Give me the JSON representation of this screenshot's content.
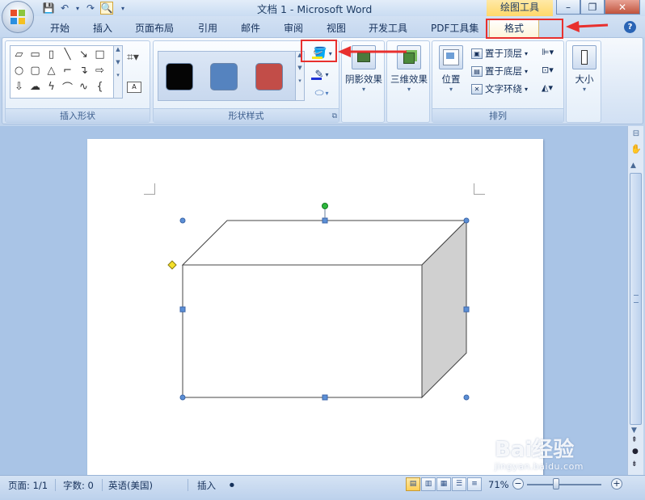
{
  "window": {
    "title": "文档 1 - Microsoft Word",
    "context_title": "绘图工具",
    "minimize": "–",
    "restore": "❐",
    "close": "✕"
  },
  "tabs": [
    "开始",
    "插入",
    "页面布局",
    "引用",
    "邮件",
    "审阅",
    "视图",
    "开发工具",
    "PDF工具集"
  ],
  "active_tab": "格式",
  "ribbon": {
    "insert_shapes_label": "插入形状",
    "shape_styles_label": "形状样式",
    "shadow_effects": "阴影效果",
    "three_d_effects": "三维效果",
    "arrange_label": "排列",
    "position": "位置",
    "bring_to_front": "置于顶层",
    "send_to_back": "置于底层",
    "text_wrapping": "文字环绕",
    "size": "大小",
    "style_swatch_colors": [
      "#050505",
      "#5583bf",
      "#c24d48"
    ],
    "fill_color": "#f7e51b",
    "outline_color": "#1e33d6"
  },
  "status": {
    "page": "页面: 1/1",
    "words": "字数: 0",
    "language": "英语(美国)",
    "mode": "插入",
    "zoom": "71%"
  },
  "watermark": {
    "brand": "Bai经验",
    "url": "jingyan.baidu.com"
  },
  "colors": {
    "accent_red": "#e8302e",
    "ribbon_bg": "#dbe7f6",
    "shape_side": "#d0d0d0",
    "handle_blue": "#5b8fd6",
    "rotation_handle": "#2db83d",
    "adjust_handle": "#f5e02a"
  }
}
